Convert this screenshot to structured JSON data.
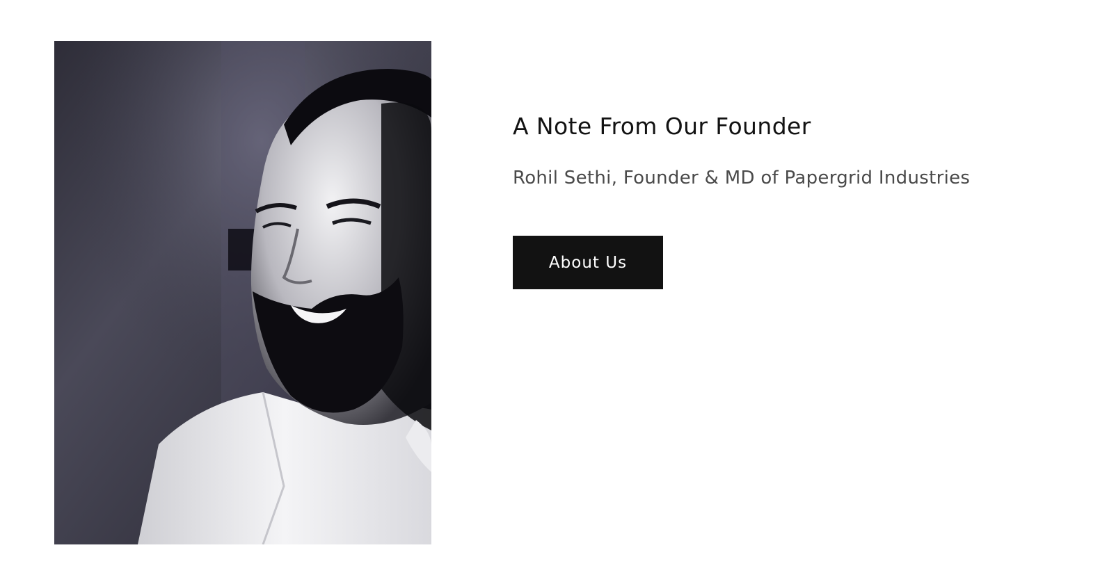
{
  "founder_section": {
    "heading": "A Note From Our Founder",
    "subheading": "Rohil Sethi, Founder & MD of Papergrid Industries",
    "button_label": "About Us",
    "portrait_alt": "Rohil Sethi"
  },
  "colors": {
    "button_bg": "#121212",
    "button_text": "#ffffff",
    "heading": "#121212",
    "subheading": "#4a4a4a"
  }
}
